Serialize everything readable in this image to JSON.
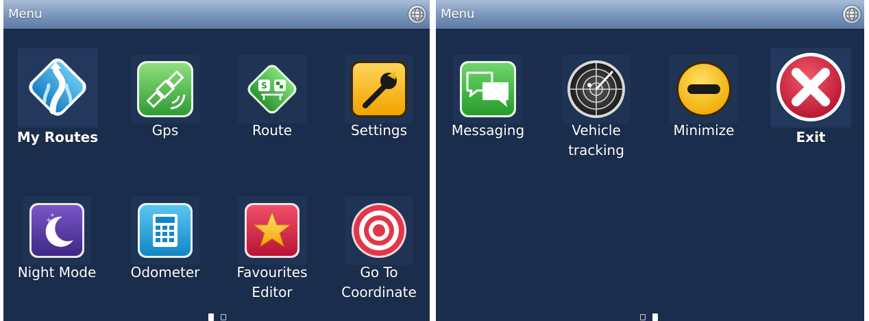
{
  "left_panel": {
    "title": "Menu",
    "items": [
      {
        "label": "My Routes",
        "icon": "my-routes-icon"
      },
      {
        "label": "Gps",
        "icon": "gps-satellite-icon"
      },
      {
        "label": "Route",
        "icon": "route-icon"
      },
      {
        "label": "Settings",
        "icon": "wrench-icon"
      },
      {
        "label": "Night Mode",
        "icon": "moon-icon"
      },
      {
        "label": "Odometer",
        "icon": "calculator-icon"
      },
      {
        "label": "Favourites\nEditor",
        "icon": "star-icon"
      },
      {
        "label": "Go To\nCoordinate",
        "icon": "target-icon"
      }
    ],
    "page_indicator": {
      "pages": 2,
      "active": 1
    }
  },
  "right_panel": {
    "title": "Menu",
    "items": [
      {
        "label": "Messaging",
        "icon": "chat-bubbles-icon"
      },
      {
        "label": "Vehicle\ntracking",
        "icon": "radar-icon"
      },
      {
        "label": "Minimize",
        "icon": "minimize-icon"
      },
      {
        "label": "Exit",
        "icon": "close-x-icon"
      }
    ],
    "page_indicator": {
      "pages": 2,
      "active": 2
    }
  },
  "colors": {
    "background": "#1b2d4c",
    "titlebar": "#7f9bbf",
    "text": "#ffffff"
  }
}
